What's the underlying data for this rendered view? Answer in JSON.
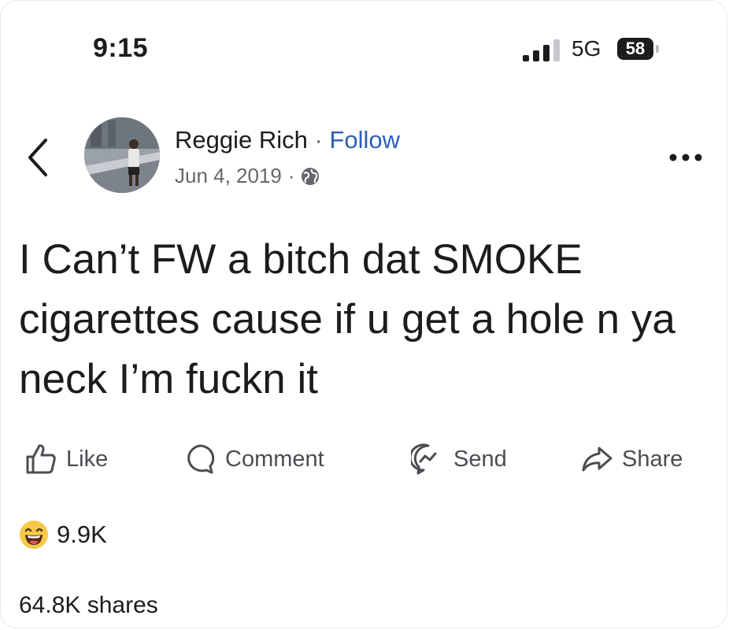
{
  "status_bar": {
    "time": "9:15",
    "network": "5G",
    "battery": "58"
  },
  "post": {
    "author": "Reggie Rich",
    "separator": "·",
    "follow_label": "Follow",
    "date": "Jun 4, 2019",
    "audience_icon": "globe-icon",
    "text": "I Can’t FW a bitch dat SMOKE cigarettes cause if u get a hole n ya neck I’m fuckn it"
  },
  "actions": {
    "like": "Like",
    "comment": "Comment",
    "send": "Send",
    "share": "Share"
  },
  "engagement": {
    "reaction_icon": "laughing-emoji-icon",
    "reaction_count": "9.9K",
    "shares": "64.8K shares"
  },
  "colors": {
    "link": "#2d5fb4",
    "muted": "#65676b",
    "text": "#1c1c1e"
  }
}
